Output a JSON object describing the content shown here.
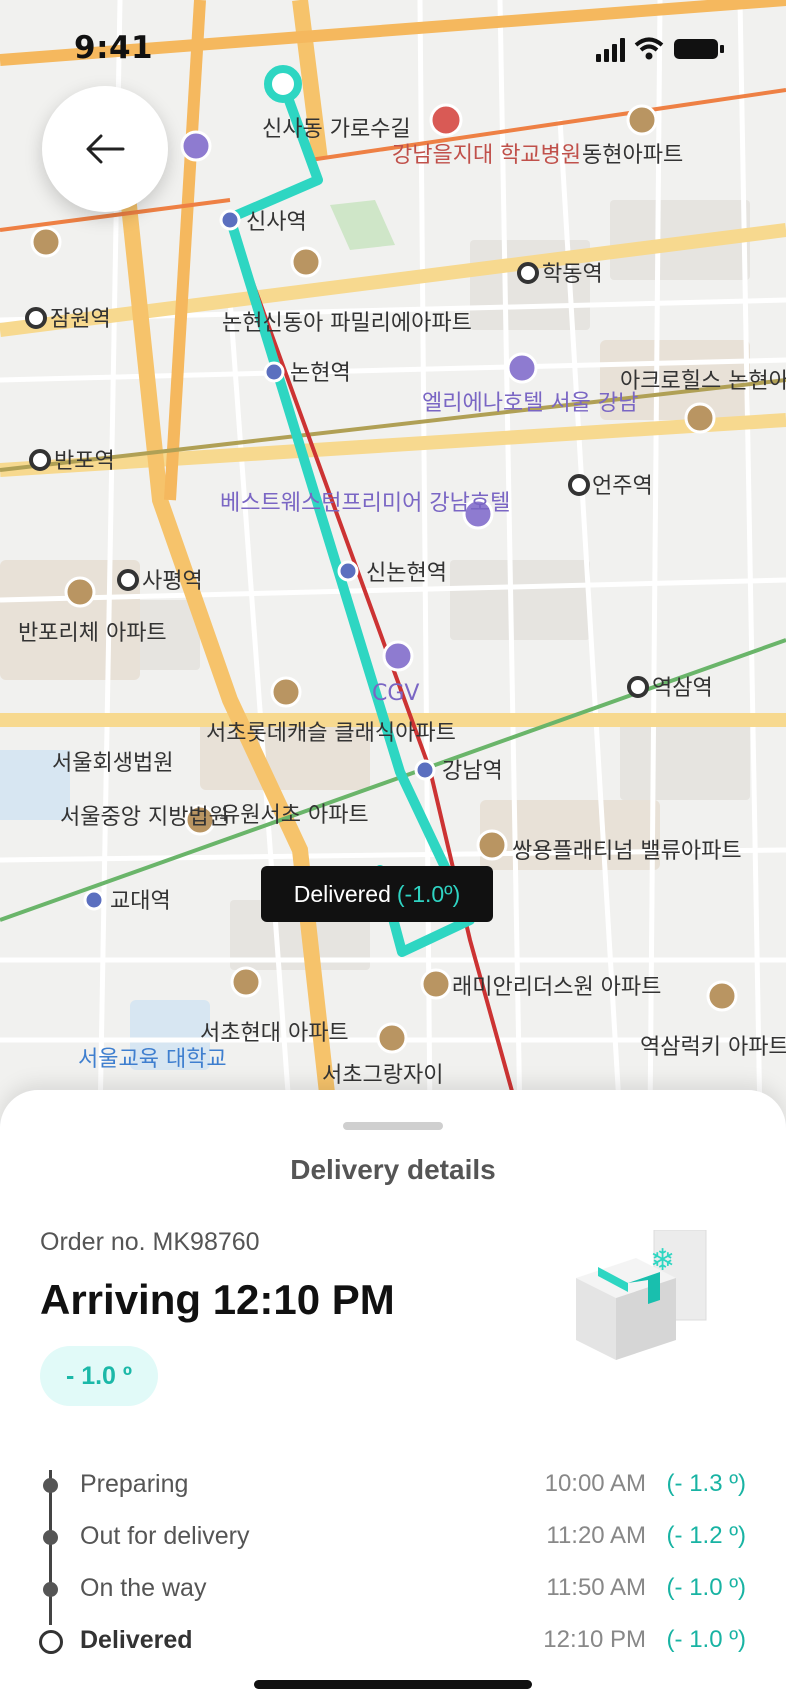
{
  "status_bar": {
    "time": "9:41"
  },
  "map": {
    "labels": {
      "sinsa": "신사역",
      "nonhyeon": "논현역",
      "sinnonhyeon": "신논현역",
      "gangnam": "강남역",
      "hakdong": "학동역",
      "eonju": "언주역",
      "yeoksam": "역삼역",
      "sapyeong": "사평역",
      "banpo": "반포역",
      "jamwon": "잠원역",
      "gyodae": "교대역",
      "hospital": "강남을지대 학교병원",
      "donghyeon": "동현아파트",
      "garosu": "신사동 가로수길",
      "nonhyeon_apt": "논현신동아 파밀리에아파트",
      "elena": "엘리에나호텔 서울 강남",
      "acro": "아크로힐스 논현아파트",
      "bestwestern": "베스트웨스턴프리미어 강남호텔",
      "banpo_apt": "반포리체 아파트",
      "seocho_lotte": "서초롯데캐슬 클래식아파트",
      "court1": "서울회생법원",
      "court2": "서울중앙 지방법원",
      "yuwon": "유원서초 아파트",
      "ssangyong": "쌍용플래티넘 밸류아파트",
      "raemian": "래미안리더스원 아파트",
      "seocho_hyundai": "서초현대 아파트",
      "seocho_grand": "서초그랑자이",
      "yeoksam_lucky": "역삼럭키 아파트",
      "edu_univ": "서울교육 대학교",
      "cgv": "CGV"
    }
  },
  "tooltip": {
    "label": "Delivered",
    "temp": "(-1.0º)"
  },
  "sheet": {
    "title": "Delivery details",
    "order_no": "Order no. MK98760",
    "arrival": "Arriving 12:10 PM",
    "temp_badge": "- 1.0 º"
  },
  "timeline": [
    {
      "label": "Preparing",
      "time": "10:00 AM",
      "temp": "(- 1.3 º)"
    },
    {
      "label": "Out for delivery",
      "time": "11:20 AM",
      "temp": "(- 1.2 º)"
    },
    {
      "label": "On the way",
      "time": "11:50 AM",
      "temp": "(- 1.0 º)"
    },
    {
      "label": "Delivered",
      "time": "12:10 PM",
      "temp": "(- 1.0 º)"
    }
  ],
  "colors": {
    "route": "#2ed6c2",
    "accent": "#18b3a3",
    "tooltip_bg": "#111111"
  }
}
